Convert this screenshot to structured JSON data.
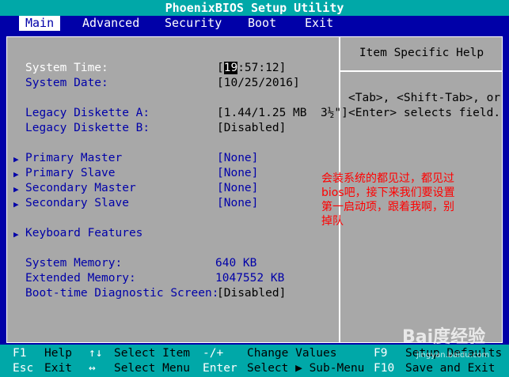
{
  "title": "PhoenixBIOS Setup Utility",
  "menu": [
    {
      "label": "Main",
      "active": true
    },
    {
      "label": "Advanced",
      "active": false
    },
    {
      "label": "Security",
      "active": false
    },
    {
      "label": "Boot",
      "active": false
    },
    {
      "label": "Exit",
      "active": false
    }
  ],
  "fields": {
    "system_time": {
      "label": "System Time:",
      "value_cursor": "19",
      "value_rest": ":57:12]"
    },
    "system_date": {
      "label": "System Date:",
      "value": "[10/25/2016]"
    },
    "legacy_a": {
      "label": "Legacy Diskette A:",
      "value": "[1.44/1.25 MB  3½\"]"
    },
    "legacy_b": {
      "label": "Legacy Diskette B:",
      "value": "[Disabled]"
    },
    "primary_master": {
      "label": "Primary Master",
      "value": "[None]"
    },
    "primary_slave": {
      "label": "Primary Slave",
      "value": "[None]"
    },
    "secondary_master": {
      "label": "Secondary Master",
      "value": "[None]"
    },
    "secondary_slave": {
      "label": "Secondary Slave",
      "value": "[None]"
    },
    "keyboard_features": {
      "label": "Keyboard Features"
    },
    "system_memory": {
      "label": "System Memory:",
      "value": "640 KB"
    },
    "extended_memory": {
      "label": "Extended Memory:",
      "value": "1047552 KB"
    },
    "diag_screen": {
      "label": "Boot-time Diagnostic Screen:",
      "value": "[Disabled]"
    }
  },
  "help": {
    "title": "Item Specific Help",
    "line1": "<Tab>, <Shift-Tab>, or",
    "line2": "<Enter> selects field."
  },
  "annotation": "会装系统的都见过，都见过bios吧，接下来我们要设置第一启动项，跟着我啊，别掉队",
  "footer": {
    "row1": [
      {
        "key": "F1",
        "desc": "Help"
      },
      {
        "key": "↑↓",
        "desc": "Select Item"
      },
      {
        "key": "-/+",
        "desc": "Change Values"
      },
      {
        "key": "F9",
        "desc": "Setup Defaults"
      }
    ],
    "row2": [
      {
        "key": "Esc",
        "desc": "Exit"
      },
      {
        "key": "↔",
        "desc": "Select Menu"
      },
      {
        "key": "Enter",
        "desc": "Select ▶ Sub-Menu"
      },
      {
        "key": "F10",
        "desc": "Save and Exit"
      }
    ]
  },
  "watermark": {
    "logo": "Bai度经验",
    "url": "jingyan.baidu.com"
  }
}
